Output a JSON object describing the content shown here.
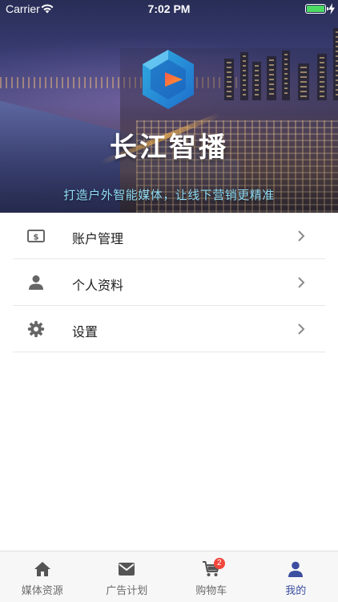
{
  "status_bar": {
    "carrier": "Carrier",
    "time": "7:02 PM",
    "battery_color": "#4cd964"
  },
  "hero": {
    "logo_icon": "changjiang-logo-icon",
    "brand": "长江智播",
    "slogan": "打造户外智能媒体，让线下营销更精准",
    "slogan_color": "#8fdcf6"
  },
  "menu": {
    "items": [
      {
        "label": "账户管理",
        "icon": "money-icon"
      },
      {
        "label": "个人资料",
        "icon": "person-icon"
      },
      {
        "label": "设置",
        "icon": "gear-icon"
      }
    ]
  },
  "tab_bar": {
    "tabs": [
      {
        "label": "媒体资源",
        "icon": "home-icon",
        "active": false
      },
      {
        "label": "广告计划",
        "icon": "mail-icon",
        "active": false
      },
      {
        "label": "购物车",
        "icon": "cart-icon",
        "active": false,
        "badge": "2"
      },
      {
        "label": "我的",
        "icon": "person-icon",
        "active": true
      }
    ],
    "active_color": "#3c4ea0",
    "badge_color": "#f2463b"
  }
}
